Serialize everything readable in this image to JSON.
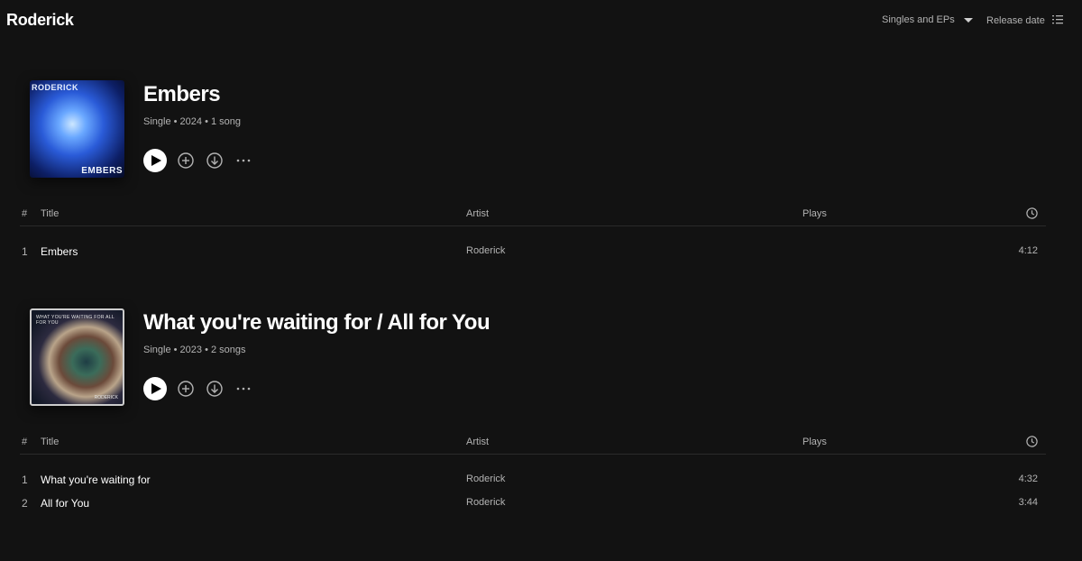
{
  "header": {
    "artist_name": "Roderick",
    "filter_label": "Singles and EPs",
    "sort_label": "Release date"
  },
  "track_columns": {
    "number": "#",
    "title": "Title",
    "artist": "Artist",
    "plays": "Plays"
  },
  "releases": [
    {
      "title": "Embers",
      "meta": "Single • 2024 • 1 song",
      "cover_text_top": "RODERICK",
      "cover_text_bottom": "EMBERS",
      "tracks": [
        {
          "number": "1",
          "title": "Embers",
          "artist": "Roderick",
          "plays": "",
          "duration": "4:12"
        }
      ]
    },
    {
      "title": "What you're waiting for / All for You",
      "meta": "Single • 2023 • 2 songs",
      "cover_text_top": "WHAT YOU'RE WAITING FOR ALL FOR YOU",
      "cover_text_bottom": "RODERICK",
      "tracks": [
        {
          "number": "1",
          "title": "What you're waiting for",
          "artist": "Roderick",
          "plays": "",
          "duration": "4:32"
        },
        {
          "number": "2",
          "title": "All for You",
          "artist": "Roderick",
          "plays": "",
          "duration": "3:44"
        }
      ]
    }
  ],
  "icons": {
    "play": "play-icon",
    "add": "add-circle-icon",
    "download": "download-circle-icon",
    "more": "more-options-icon",
    "duration": "clock-icon",
    "list_view": "list-view-icon",
    "dropdown": "caret-down-icon"
  },
  "colors": {
    "background": "#121212",
    "text_primary": "#ffffff",
    "text_secondary": "#b3b3b3",
    "divider": "#2a2a2a"
  }
}
